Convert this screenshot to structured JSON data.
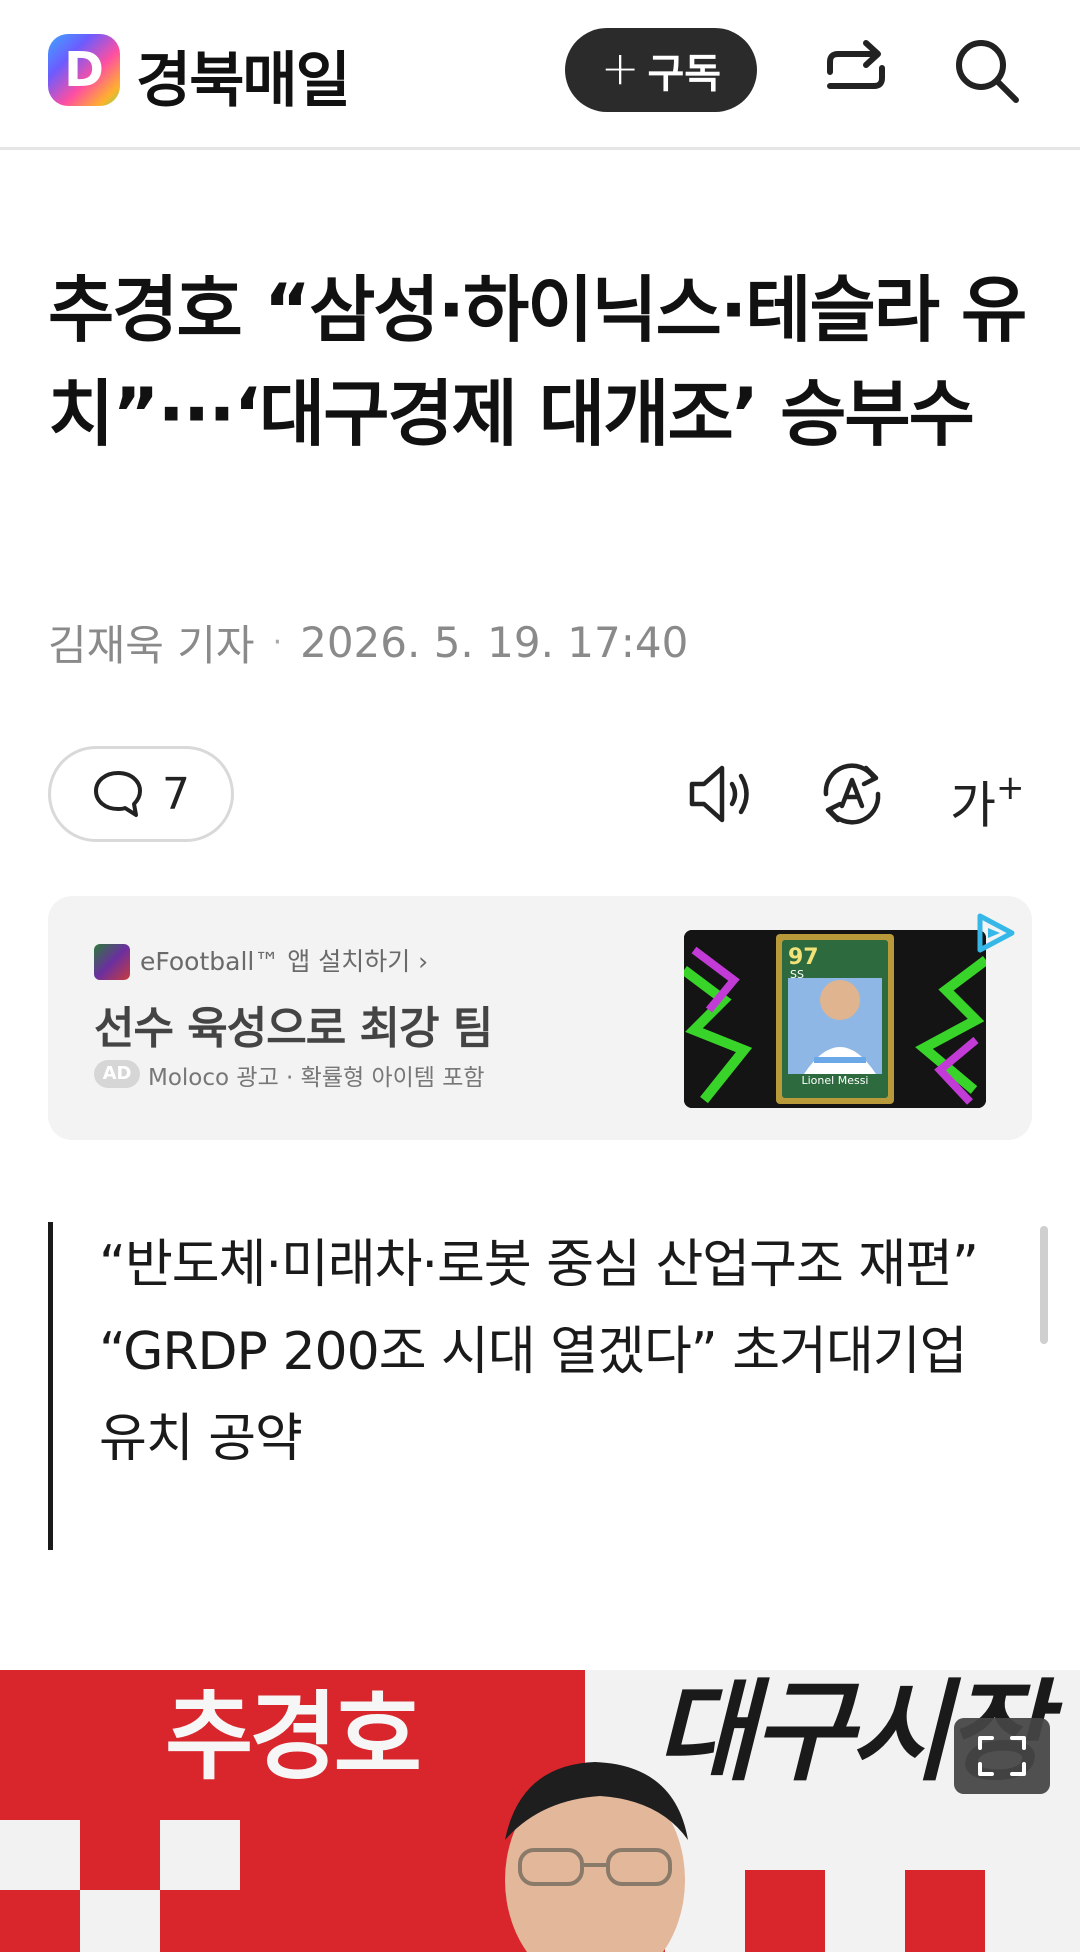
{
  "header": {
    "logo_letter": "D",
    "brand": "경북매일",
    "subscribe_plus": "+",
    "subscribe_label": "구독",
    "share_icon": "share-icon",
    "search_icon": "search-icon"
  },
  "article": {
    "title": "추경호 “삼성·하이닉스·테슬라 유치”···‘대구경제 대개조’ 승부수",
    "reporter": "김재욱 기자",
    "separator": "·",
    "datetime": "2026. 5. 19. 17:40",
    "comment_count": "7",
    "subheadline": [
      "“반도체·미래차·로봇 중심 산업구조 재편”",
      "“GRDP 200조 시대 열겠다” 초거대기업 유치 공약"
    ]
  },
  "toolbar": {
    "fontsize_label": "가",
    "fontsize_plus": "+"
  },
  "ad": {
    "app_line": "eFootball™ 앱 설치하기 ›",
    "headline": "선수 육성으로 최강 팀",
    "badge": "AD",
    "disclosure": "Moloco 광고 · 확률형 아이템 포함",
    "card_rating": "97",
    "card_position": "SS",
    "card_player": "Lionel Messi"
  },
  "photo": {
    "sign_left": "추경호",
    "sign_right": "대구시장"
  },
  "colors": {
    "subscribe_bg": "#2b2b2b",
    "photo_red": "#d8262c",
    "ad_bg": "#f3f3f3"
  }
}
